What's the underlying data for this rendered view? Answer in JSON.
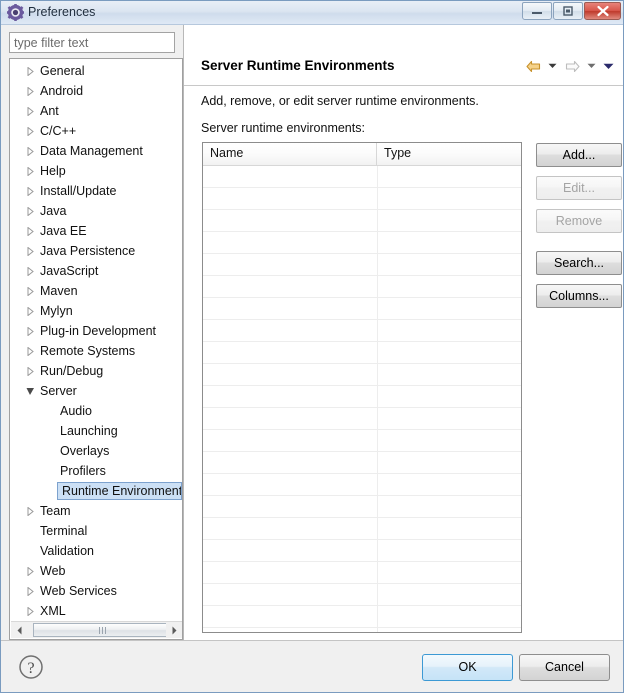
{
  "window": {
    "title": "Preferences",
    "icon": "preferences-gear-icon",
    "controls": {
      "minimize": "minimize-icon",
      "maximize": "restore-icon",
      "close": "close-icon"
    }
  },
  "sidebar": {
    "filter": {
      "value": "",
      "placeholder": "type filter text"
    },
    "items": [
      {
        "label": "General",
        "level": 0,
        "expandable": true,
        "expanded": false,
        "selected": false
      },
      {
        "label": "Android",
        "level": 0,
        "expandable": true,
        "expanded": false,
        "selected": false
      },
      {
        "label": "Ant",
        "level": 0,
        "expandable": true,
        "expanded": false,
        "selected": false
      },
      {
        "label": "C/C++",
        "level": 0,
        "expandable": true,
        "expanded": false,
        "selected": false
      },
      {
        "label": "Data Management",
        "level": 0,
        "expandable": true,
        "expanded": false,
        "selected": false
      },
      {
        "label": "Help",
        "level": 0,
        "expandable": true,
        "expanded": false,
        "selected": false
      },
      {
        "label": "Install/Update",
        "level": 0,
        "expandable": true,
        "expanded": false,
        "selected": false
      },
      {
        "label": "Java",
        "level": 0,
        "expandable": true,
        "expanded": false,
        "selected": false
      },
      {
        "label": "Java EE",
        "level": 0,
        "expandable": true,
        "expanded": false,
        "selected": false
      },
      {
        "label": "Java Persistence",
        "level": 0,
        "expandable": true,
        "expanded": false,
        "selected": false
      },
      {
        "label": "JavaScript",
        "level": 0,
        "expandable": true,
        "expanded": false,
        "selected": false
      },
      {
        "label": "Maven",
        "level": 0,
        "expandable": true,
        "expanded": false,
        "selected": false
      },
      {
        "label": "Mylyn",
        "level": 0,
        "expandable": true,
        "expanded": false,
        "selected": false
      },
      {
        "label": "Plug-in Development",
        "level": 0,
        "expandable": true,
        "expanded": false,
        "selected": false
      },
      {
        "label": "Remote Systems",
        "level": 0,
        "expandable": true,
        "expanded": false,
        "selected": false
      },
      {
        "label": "Run/Debug",
        "level": 0,
        "expandable": true,
        "expanded": false,
        "selected": false
      },
      {
        "label": "Server",
        "level": 0,
        "expandable": true,
        "expanded": true,
        "selected": false
      },
      {
        "label": "Audio",
        "level": 1,
        "expandable": false,
        "expanded": false,
        "selected": false
      },
      {
        "label": "Launching",
        "level": 1,
        "expandable": false,
        "expanded": false,
        "selected": false
      },
      {
        "label": "Overlays",
        "level": 1,
        "expandable": false,
        "expanded": false,
        "selected": false
      },
      {
        "label": "Profilers",
        "level": 1,
        "expandable": false,
        "expanded": false,
        "selected": false
      },
      {
        "label": "Runtime Environment",
        "level": 1,
        "expandable": false,
        "expanded": false,
        "selected": true
      },
      {
        "label": "Team",
        "level": 0,
        "expandable": true,
        "expanded": false,
        "selected": false
      },
      {
        "label": "Terminal",
        "level": 0,
        "expandable": false,
        "expanded": false,
        "selected": false
      },
      {
        "label": "Validation",
        "level": 0,
        "expandable": false,
        "expanded": false,
        "selected": false
      },
      {
        "label": "Web",
        "level": 0,
        "expandable": true,
        "expanded": false,
        "selected": false
      },
      {
        "label": "Web Services",
        "level": 0,
        "expandable": true,
        "expanded": false,
        "selected": false
      },
      {
        "label": "XML",
        "level": 0,
        "expandable": true,
        "expanded": false,
        "selected": false
      }
    ],
    "scrollbar": {
      "left_arrow": "scroll-left-icon",
      "right_arrow": "scroll-right-icon"
    }
  },
  "page": {
    "title": "Server Runtime Environments",
    "description": "Add, remove, or edit server runtime environments.",
    "table_label": "Server runtime environments:",
    "nav": {
      "back": {
        "icon": "back-arrow-icon",
        "enabled": true
      },
      "back_menu": {
        "icon": "chevron-down-icon"
      },
      "forward": {
        "icon": "forward-arrow-icon",
        "enabled": false
      },
      "forward_menu": {
        "icon": "chevron-down-icon"
      },
      "view_menu": {
        "icon": "chevron-down-icon"
      }
    },
    "table": {
      "columns": [
        "Name",
        "Type"
      ],
      "rows": [],
      "empty_row_count": 22
    },
    "buttons": [
      {
        "label": "Add...",
        "name": "add-button",
        "enabled": true
      },
      {
        "label": "Edit...",
        "name": "edit-button",
        "enabled": false
      },
      {
        "label": "Remove",
        "name": "remove-button",
        "enabled": false
      },
      {
        "label": "Search...",
        "name": "search-button",
        "enabled": true
      },
      {
        "label": "Columns...",
        "name": "columns-button",
        "enabled": true
      }
    ]
  },
  "footer": {
    "help_icon": "help-question-icon",
    "ok_label": "OK",
    "cancel_label": "Cancel"
  },
  "colors": {
    "selection": "#cce0f5",
    "selection_border": "#7da2ce",
    "default_button_border": "#3c99d4",
    "close_button": "#d8564a",
    "back_arrow": "#e8a33d"
  }
}
